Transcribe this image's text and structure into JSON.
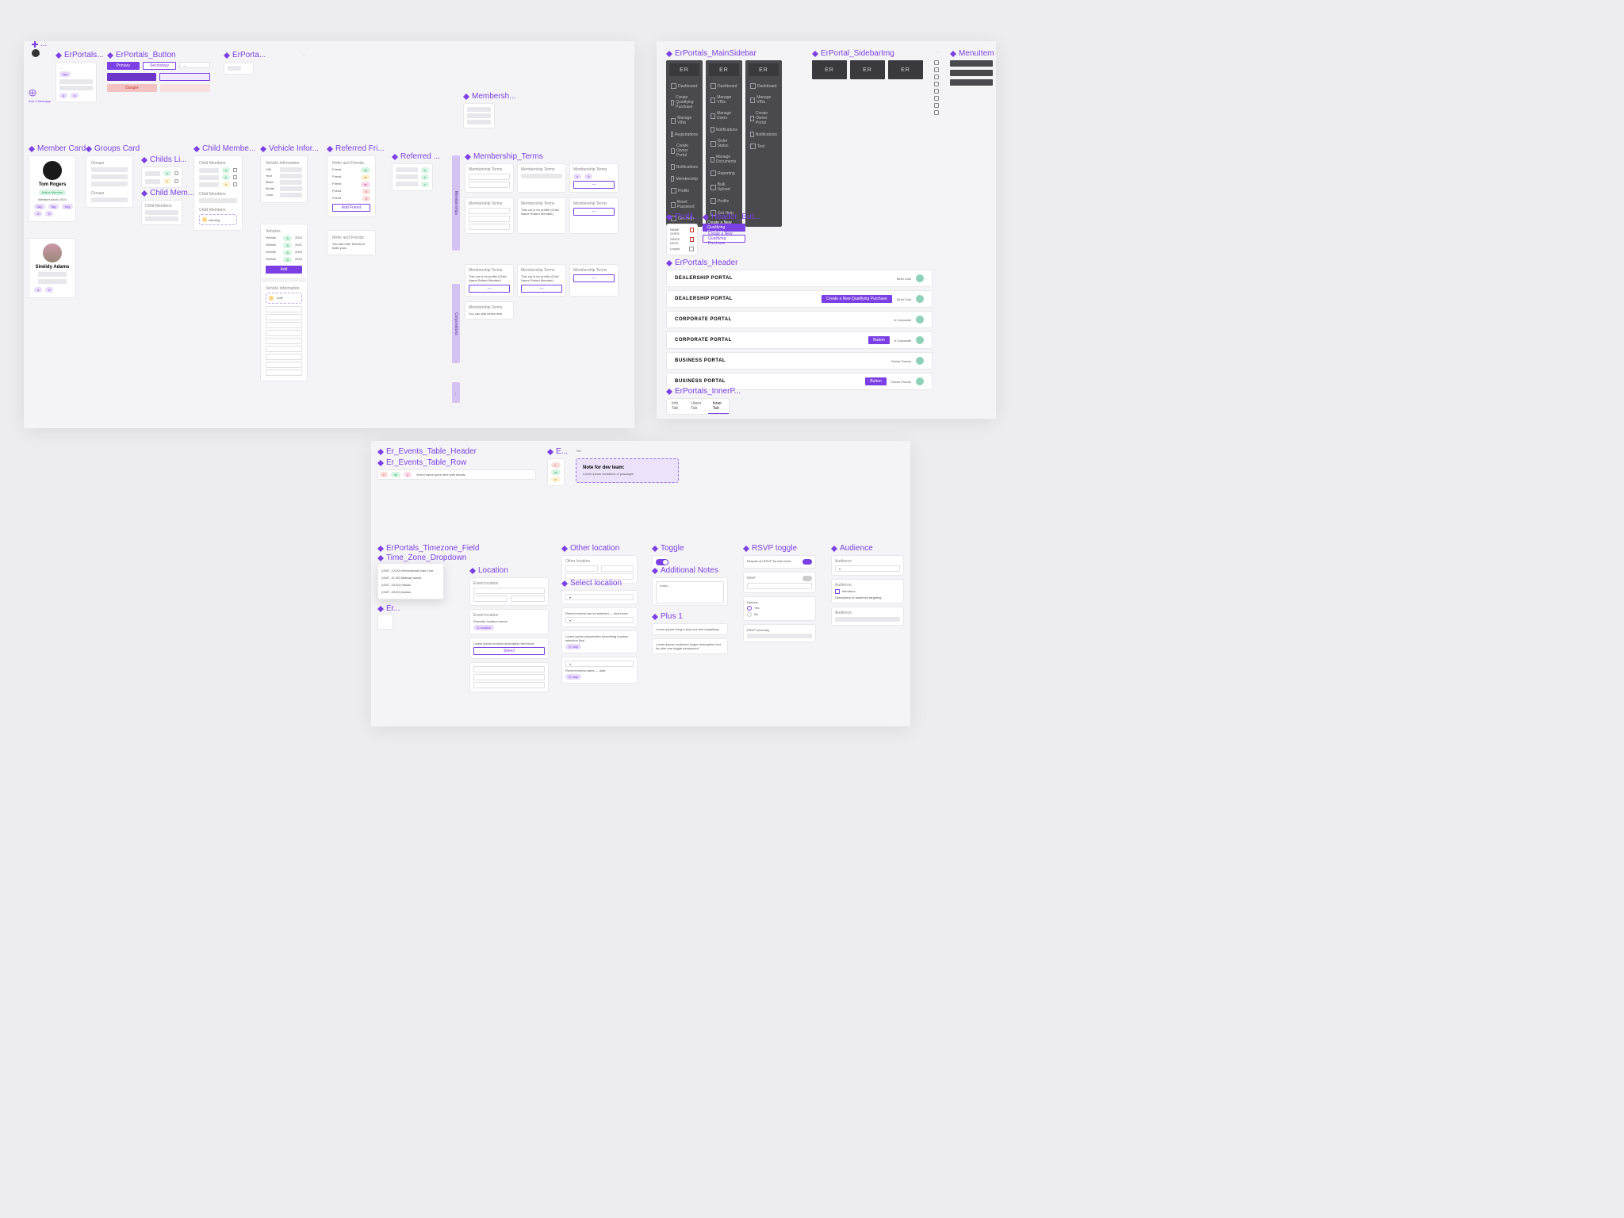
{
  "frames": {
    "top_left": "ErPortals...",
    "button": "ErPortals_Button",
    "ta": "ErPorta...",
    "member_card": "Member Card",
    "groups_card": "Groups Card",
    "childs_li": "Childs Li...",
    "child_mem": "Child Mem...",
    "child_membe": "Child Membe...",
    "vehicle_info": "Vehicle Infor...",
    "referred_fri": "Referred Fri...",
    "referred": "Referred ...",
    "membership_dd": "Membersh...",
    "membership_terms": "Membership_Terms",
    "main_sidebar": "ErPortals_MainSidebar",
    "sidebar_img": "ErPortal_SidebarImg",
    "menu_item": "MenuItem",
    "profil": "Profil...",
    "header_btn": "Header_But...",
    "header": "ErPortals_Header",
    "inner_p": "ErPortals_InnerP...",
    "events_header": "Er_Events_Table_Header",
    "events_row": "Er_Events_Table_Row",
    "e_short": "E...",
    "tz_field": "ErPortals_Timezone_Field",
    "tz_dd": "Time_Zone_Dropdown",
    "er_short": "Er...",
    "location": "Location",
    "other_loc": "Other location",
    "select_loc": "Select location",
    "toggle": "Toggle",
    "notes": "Additional Notes",
    "plus1": "Plus 1",
    "rsvp": "RSVP toggle",
    "audience": "Audience",
    "title": "Title"
  },
  "buttons": {
    "primary": "Primary",
    "secondary": "Secondary",
    "danger": "Danger"
  },
  "member1": {
    "name": "Tom Rogers",
    "tagline": "Active Member",
    "meta": "Member since 2019"
  },
  "member2": {
    "name": "Sinéidy Adams"
  },
  "sidebar_items": [
    "Dashboard",
    "Create Qualifying Purchase",
    "Manage VINs",
    "Registrations",
    "Create Owner Portal",
    "Notifications",
    "Membership",
    "Profile",
    "Reset Password",
    "Get Help"
  ],
  "sidebar_items_b": [
    "Dashboard",
    "Manage VINs",
    "Manage Users",
    "Notifications",
    "Order Status",
    "Manage Documents",
    "Reporting",
    "Bulk Upload",
    "Profile",
    "Get Help"
  ],
  "sidebar_items_c": [
    "Dashboard",
    "Manage VINs",
    "Create Owner Portal",
    "Notifications",
    "Test"
  ],
  "logo": "ER",
  "profil": {
    "name_lbl": "NAME GOES:",
    "date_lbl": "SINCE DATE:",
    "logout": "Logout"
  },
  "header_btn_label": "Create a New Qualifying Purchase",
  "headers": [
    {
      "title": "DEALERSHIP PORTAL",
      "right": "Sinéi Colo",
      "btn": ""
    },
    {
      "title": "DEALERSHIP PORTAL",
      "right": "Sinéi Colo",
      "btn": "Create a New Qualifying Purchase"
    },
    {
      "title": "CORPORATE PORTAL",
      "right": "A Corporate",
      "btn": ""
    },
    {
      "title": "CORPORATE PORTAL",
      "right": "A Corporate",
      "btn": "Button"
    },
    {
      "title": "BUSINESS PORTAL",
      "right": "Owner Fname",
      "btn": ""
    },
    {
      "title": "BUSINESS PORTAL",
      "right": "Owner Fname",
      "btn": "Button"
    }
  ],
  "inner_tabs": [
    "Info Tab",
    "Users Tab",
    "Inner Tab"
  ],
  "banner": {
    "title": "Title",
    "heading": "Note for dev team:",
    "body": "Lorem ipsum variations of passages"
  },
  "terms_heading": "Membership Terms",
  "terms_note": "This car is for profile (Child Name Robert Member)",
  "referred_heading": "Refer and Friends",
  "groups": {
    "heading": "Groups"
  },
  "tz_options": [
    "(GMT -12:00) International Date Line",
    "(GMT -11:00) Midway Island",
    "(GMT -10:00) Hawaii",
    "(GMT -09:00) Alaska"
  ]
}
